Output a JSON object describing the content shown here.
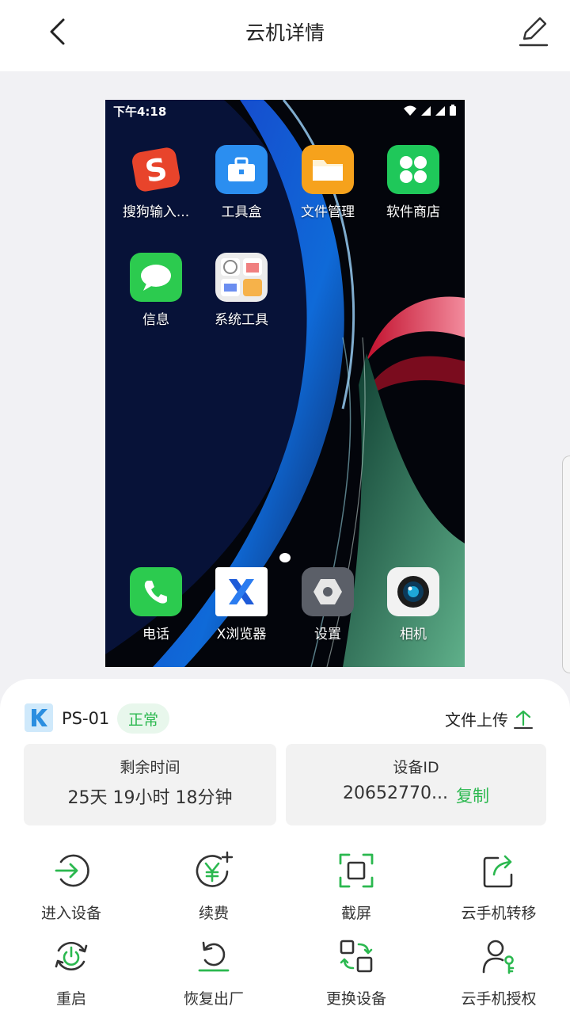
{
  "header": {
    "title": "云机详情",
    "back_icon": "chevron-left-icon",
    "edit_icon": "edit-icon"
  },
  "phone_screen": {
    "status_time": "下午4:18",
    "apps_top": [
      {
        "label": "搜狗输入...",
        "icon": "sogou-icon",
        "color": "#e8442b"
      },
      {
        "label": "工具盒",
        "icon": "toolbox-icon",
        "color": "#2b8ef0"
      },
      {
        "label": "文件管理",
        "icon": "folder-icon",
        "color": "#f6a21c"
      },
      {
        "label": "软件商店",
        "icon": "app-store-icon",
        "color": "#1fc85a"
      },
      {
        "label": "信息",
        "icon": "message-icon",
        "color": "#2ccb4f"
      },
      {
        "label": "系统工具",
        "icon": "system-tools-icon",
        "color": "#e9e9e9"
      }
    ],
    "apps_dock": [
      {
        "label": "电话",
        "icon": "phone-icon",
        "color": "#2ccb4f"
      },
      {
        "label": "X浏览器",
        "icon": "x-browser-icon",
        "color": "#ffffff"
      },
      {
        "label": "设置",
        "icon": "settings-icon",
        "color": "#5b5f68"
      },
      {
        "label": "相机",
        "icon": "camera-icon",
        "color": "#f2f2f2"
      }
    ]
  },
  "device": {
    "name": "PS-01",
    "status": "正常",
    "upload_label": "文件上传",
    "remaining_title": "剩余时间",
    "remaining_value": "25天 19小时 18分钟",
    "id_title": "设备ID",
    "id_value": "20652770...",
    "copy_label": "复制"
  },
  "actions": [
    {
      "label": "进入设备",
      "icon": "enter-device-icon"
    },
    {
      "label": "续费",
      "icon": "renew-icon"
    },
    {
      "label": "截屏",
      "icon": "screenshot-icon"
    },
    {
      "label": "云手机转移",
      "icon": "transfer-icon"
    },
    {
      "label": "重启",
      "icon": "restart-icon"
    },
    {
      "label": "恢复出厂",
      "icon": "factory-reset-icon"
    },
    {
      "label": "更换设备",
      "icon": "replace-device-icon"
    },
    {
      "label": "云手机授权",
      "icon": "authorize-icon"
    }
  ],
  "colors": {
    "accent": "#2bb84f",
    "background": "#f1f1f4",
    "panel": "#ffffff"
  }
}
